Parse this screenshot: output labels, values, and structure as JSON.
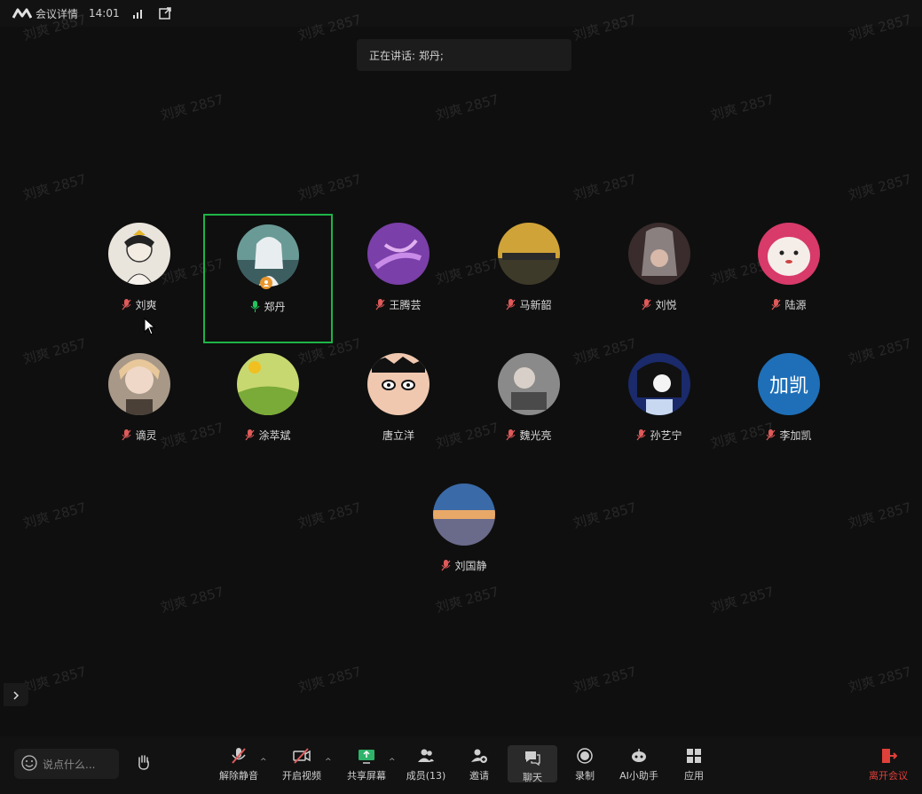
{
  "topbar": {
    "meeting_details": "会议详情",
    "time": "14:01"
  },
  "speaking": {
    "text": "正在讲话: 郑丹;"
  },
  "watermark": "刘爽 2857",
  "participants": [
    {
      "name": "刘爽",
      "muted": true
    },
    {
      "name": "郑丹",
      "muted": false,
      "speaking": true,
      "host": true
    },
    {
      "name": "王腾芸",
      "muted": true
    },
    {
      "name": "马新韶",
      "muted": true
    },
    {
      "name": "刘悦",
      "muted": true
    },
    {
      "name": "陆源",
      "muted": true
    },
    {
      "name": "谪灵",
      "muted": true
    },
    {
      "name": "涂萃斌",
      "muted": true
    },
    {
      "name": "唐立洋",
      "muted": false
    },
    {
      "name": "魏光亮",
      "muted": true
    },
    {
      "name": "孙艺宁",
      "muted": true
    },
    {
      "name": "李加凯",
      "muted": true,
      "initials": "加凯"
    },
    {
      "name": "刘国静",
      "muted": true
    }
  ],
  "toolbar": {
    "chat_placeholder": "说点什么...",
    "unmute": "解除静音",
    "start_video": "开启视频",
    "share_screen": "共享屏幕",
    "members": "成员(13)",
    "invite": "邀请",
    "chat": "聊天",
    "record": "录制",
    "ai_assistant": "AI小助手",
    "apps": "应用",
    "leave": "离开会议"
  },
  "colors": {
    "active_border": "#1db446",
    "muted_mic": "#e05a5a",
    "leave": "#e0403a",
    "accent": "#1e6fb8"
  }
}
